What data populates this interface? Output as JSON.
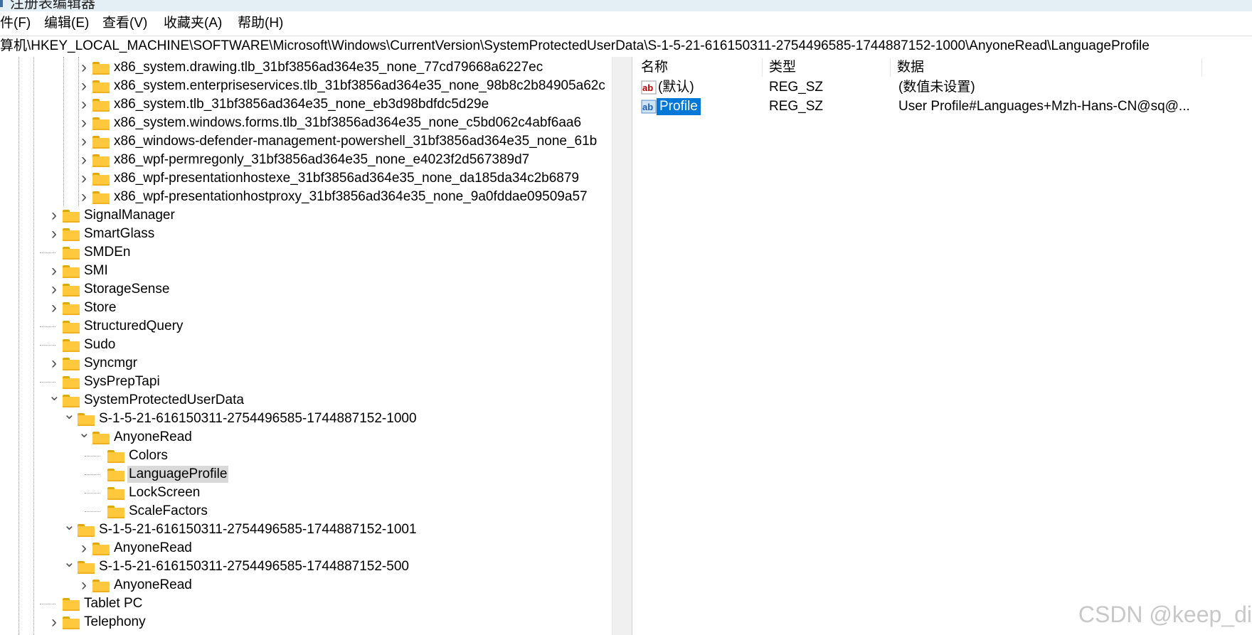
{
  "window": {
    "title": "注册表编辑器"
  },
  "menu": [
    {
      "label": "件(F)"
    },
    {
      "label": "编辑(E)"
    },
    {
      "label": "查看(V)"
    },
    {
      "label": "收藏夹(A)"
    },
    {
      "label": "帮助(H)"
    }
  ],
  "address": {
    "path": "算机\\HKEY_LOCAL_MACHINE\\SOFTWARE\\Microsoft\\Windows\\CurrentVersion\\SystemProtectedUserData\\S-1-5-21-616150311-2754496585-1744887152-1000\\AnyoneRead\\LanguageProfile"
  },
  "tree": {
    "nodes": [
      {
        "label": "x86_system.drawing.tlb_31bf3856ad364e35_none_77cd79668a6227ec",
        "arrow": ">",
        "selected": false
      },
      {
        "label": "x86_system.enterpriseservices.tlb_31bf3856ad364e35_none_98b8c2b84905a62c",
        "arrow": ">",
        "selected": false
      },
      {
        "label": "x86_system.tlb_31bf3856ad364e35_none_eb3d98bdfdc5d29e",
        "arrow": ">",
        "selected": false
      },
      {
        "label": "x86_system.windows.forms.tlb_31bf3856ad364e35_none_c5bd062c4abf6aa6",
        "arrow": ">",
        "selected": false
      },
      {
        "label": "x86_windows-defender-management-powershell_31bf3856ad364e35_none_61b",
        "arrow": ">",
        "selected": false
      },
      {
        "label": "x86_wpf-permregonly_31bf3856ad364e35_none_e4023f2d567389d7",
        "arrow": ">",
        "selected": false
      },
      {
        "label": "x86_wpf-presentationhostexe_31bf3856ad364e35_none_da185da34c2b6879",
        "arrow": ">",
        "selected": false
      },
      {
        "label": "x86_wpf-presentationhostproxy_31bf3856ad364e35_none_9a0fddae09509a57",
        "arrow": ">",
        "selected": false
      },
      {
        "label": "SignalManager",
        "arrow": ">",
        "selected": false
      },
      {
        "label": "SmartGlass",
        "arrow": ">",
        "selected": false
      },
      {
        "label": "SMDEn",
        "arrow": "",
        "selected": false
      },
      {
        "label": "SMI",
        "arrow": ">",
        "selected": false
      },
      {
        "label": "StorageSense",
        "arrow": ">",
        "selected": false
      },
      {
        "label": "Store",
        "arrow": ">",
        "selected": false
      },
      {
        "label": "StructuredQuery",
        "arrow": "",
        "selected": false
      },
      {
        "label": "Sudo",
        "arrow": "",
        "selected": false
      },
      {
        "label": "Syncmgr",
        "arrow": ">",
        "selected": false
      },
      {
        "label": "SysPrepTapi",
        "arrow": "",
        "selected": false
      },
      {
        "label": "SystemProtectedUserData",
        "arrow": "v",
        "selected": false
      },
      {
        "label": "S-1-5-21-616150311-2754496585-1744887152-1000",
        "arrow": "v",
        "selected": false
      },
      {
        "label": "AnyoneRead",
        "arrow": "v",
        "selected": false
      },
      {
        "label": "Colors",
        "arrow": "",
        "selected": false
      },
      {
        "label": "LanguageProfile",
        "arrow": "",
        "selected": true
      },
      {
        "label": "LockScreen",
        "arrow": "",
        "selected": false
      },
      {
        "label": "ScaleFactors",
        "arrow": "",
        "selected": false
      },
      {
        "label": "S-1-5-21-616150311-2754496585-1744887152-1001",
        "arrow": "v",
        "selected": false
      },
      {
        "label": "AnyoneRead",
        "arrow": ">",
        "selected": false
      },
      {
        "label": "S-1-5-21-616150311-2754496585-1744887152-500",
        "arrow": "v",
        "selected": false
      },
      {
        "label": "AnyoneRead",
        "arrow": ">",
        "selected": false
      },
      {
        "label": "Tablet PC",
        "arrow": "",
        "selected": false
      },
      {
        "label": "Telephony",
        "arrow": ">",
        "selected": false
      },
      {
        "label": "",
        "arrow": ">",
        "selected": false
      }
    ]
  },
  "values": {
    "columns": {
      "name": "名称",
      "type": "类型",
      "data": "数据"
    },
    "rows": [
      {
        "name": "(默认)",
        "type": "REG_SZ",
        "data": "(数值未设置)",
        "icon": "string-value-icon",
        "selected": false
      },
      {
        "name": "Profile",
        "type": "REG_SZ",
        "data": "User Profile#Languages+Mzh-Hans-CN@sq@...",
        "icon": "string-value-icon",
        "selected": true
      }
    ]
  },
  "watermark": "CSDN @keep_di"
}
